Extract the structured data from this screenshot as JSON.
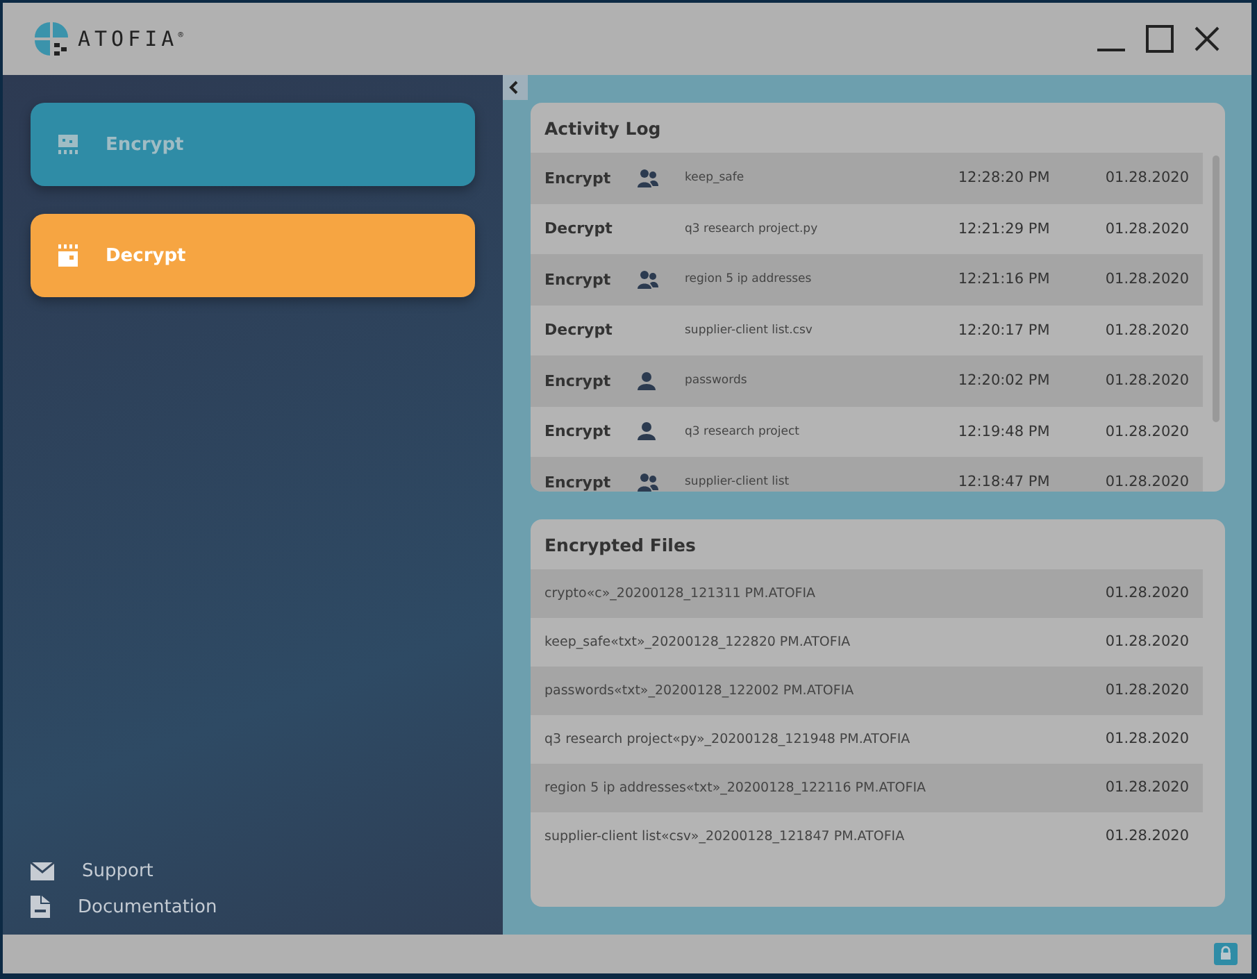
{
  "window": {
    "logo": "ATOFIA",
    "logo_mark": "®"
  },
  "nav": [
    {
      "label": "Encrypt",
      "kind": "encrypt",
      "color": "#2f8ca6",
      "selected": false
    },
    {
      "label": "Decrypt",
      "kind": "decrypt",
      "color": "#f6a542",
      "selected": true
    }
  ],
  "links": [
    {
      "label": "Support",
      "kind": "mail"
    },
    {
      "label": "Documentation",
      "kind": "doc"
    }
  ],
  "activity_log": {
    "title": "Activity Log",
    "rows": [
      {
        "action": "Encrypt",
        "kind": "group",
        "file": "keep_safe",
        "time": "12:28:20 PM",
        "date": "01.28.2020"
      },
      {
        "action": "Decrypt",
        "kind": "none",
        "file": "q3 research project.py",
        "time": "12:21:29 PM",
        "date": "01.28.2020"
      },
      {
        "action": "Encrypt",
        "kind": "group",
        "file": "region 5 ip addresses",
        "time": "12:21:16 PM",
        "date": "01.28.2020"
      },
      {
        "action": "Decrypt",
        "kind": "none",
        "file": "supplier-client list.csv",
        "time": "12:20:17 PM",
        "date": "01.28.2020"
      },
      {
        "action": "Encrypt",
        "kind": "single",
        "file": "passwords",
        "time": "12:20:02 PM",
        "date": "01.28.2020"
      },
      {
        "action": "Encrypt",
        "kind": "single",
        "file": "q3 research project",
        "time": "12:19:48 PM",
        "date": "01.28.2020"
      },
      {
        "action": "Encrypt",
        "kind": "group",
        "file": "supplier-client list",
        "time": "12:18:47 PM",
        "date": "01.28.2020"
      }
    ]
  },
  "encrypted_files": {
    "title": "Encrypted Files",
    "rows": [
      {
        "name": "crypto«c»_20200128_121311 PM.ATOFIA",
        "date": "01.28.2020"
      },
      {
        "name": "keep_safe«txt»_20200128_122820 PM.ATOFIA",
        "date": "01.28.2020"
      },
      {
        "name": "passwords«txt»_20200128_122002 PM.ATOFIA",
        "date": "01.28.2020"
      },
      {
        "name": "q3 research project«py»_20200128_121948 PM.ATOFIA",
        "date": "01.28.2020"
      },
      {
        "name": "region 5 ip addresses«txt»_20200128_122116 PM.ATOFIA",
        "date": "01.28.2020"
      },
      {
        "name": "supplier-client list«csv»_20200128_121847 PM.ATOFIA",
        "date": "01.28.2020"
      }
    ]
  }
}
